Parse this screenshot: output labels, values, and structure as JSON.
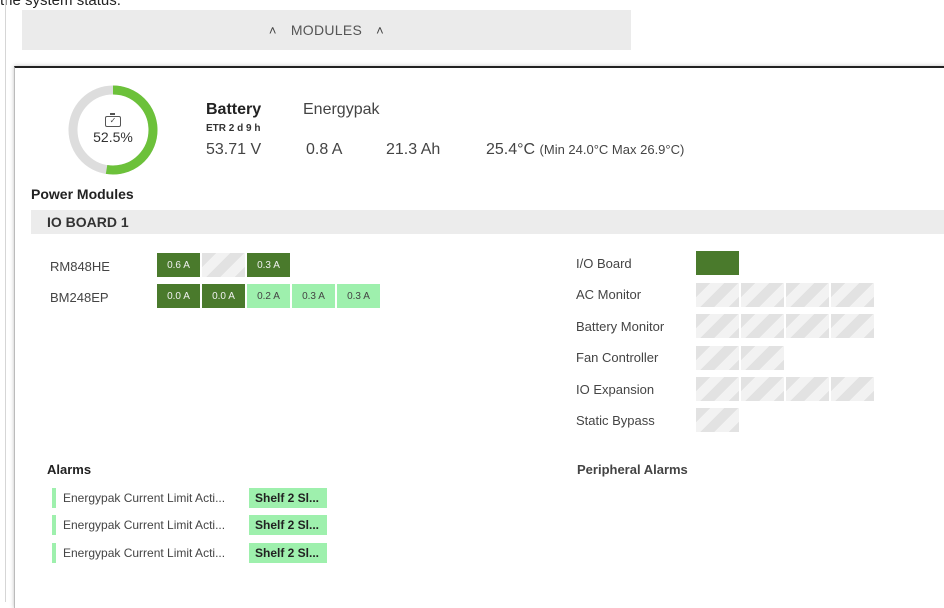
{
  "header": {
    "caption": "the system status.",
    "modules_label": "MODULES"
  },
  "battery": {
    "percent_text": "52.5%",
    "percent_value": 52.5,
    "title": "Battery",
    "name": "Energypak",
    "etr": "ETR 2 d 9 h",
    "voltage": "53.71 V",
    "current": "0.8 A",
    "capacity": "21.3 Ah",
    "temperature": "25.4°C",
    "temperature_range": "(Min 24.0°C Max 26.9°C)",
    "gauge_fill_color": "#6cc13a",
    "gauge_track_color": "#dddddd"
  },
  "power_modules": {
    "heading": "Power Modules",
    "board_title": "IO BOARD 1",
    "modules": [
      {
        "name": "RM848HE",
        "cells": [
          {
            "label": "0.6 A",
            "state": "dark"
          },
          {
            "label": "",
            "state": "empty"
          },
          {
            "label": "0.3 A",
            "state": "dark"
          }
        ]
      },
      {
        "name": "BM248EP",
        "cells": [
          {
            "label": "0.0 A",
            "state": "dark"
          },
          {
            "label": "0.0 A",
            "state": "dark"
          },
          {
            "label": "0.2 A",
            "state": "light"
          },
          {
            "label": "0.3 A",
            "state": "light"
          },
          {
            "label": "0.3 A",
            "state": "light"
          }
        ]
      }
    ],
    "peripherals": [
      {
        "name": "I/O Board",
        "cells": [
          "dark"
        ]
      },
      {
        "name": "AC Monitor",
        "cells": [
          "empty",
          "empty",
          "empty",
          "empty"
        ]
      },
      {
        "name": "Battery Monitor",
        "cells": [
          "empty",
          "empty",
          "empty",
          "empty"
        ]
      },
      {
        "name": "Fan Controller",
        "cells": [
          "empty",
          "empty"
        ]
      },
      {
        "name": "IO Expansion",
        "cells": [
          "empty",
          "empty",
          "empty",
          "empty"
        ]
      },
      {
        "name": "Static Bypass",
        "cells": [
          "empty"
        ]
      }
    ]
  },
  "alarms": {
    "heading": "Alarms",
    "items": [
      {
        "text": "Energypak Current Limit Acti...",
        "tag": "Shelf 2 Sl..."
      },
      {
        "text": "Energypak Current Limit Acti...",
        "tag": "Shelf 2 Sl..."
      },
      {
        "text": "Energypak Current Limit Acti...",
        "tag": "Shelf 2 Sl..."
      }
    ]
  },
  "peripheral_alarms": {
    "heading": "Peripheral Alarms"
  },
  "icons": {
    "collapse": "chevron-up-icon",
    "battery": "battery-check-icon"
  }
}
